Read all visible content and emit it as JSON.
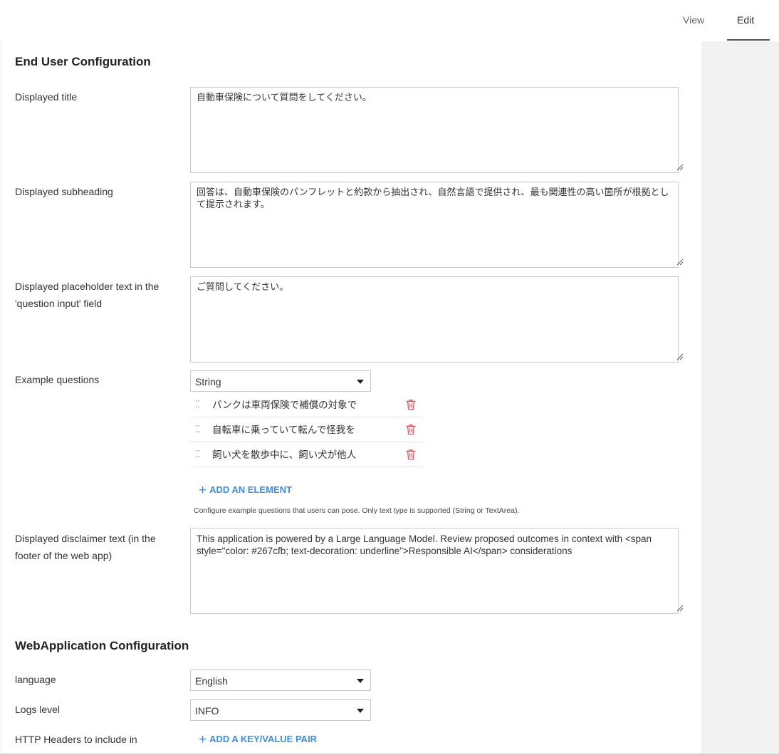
{
  "tabs": {
    "view": "View",
    "edit": "Edit"
  },
  "sections": {
    "end_user": "End User Configuration",
    "webapp": "WebApplication Configuration"
  },
  "fields": {
    "title": {
      "label": "Displayed title",
      "value": "自動車保険について質問をしてください。"
    },
    "subheading": {
      "label": "Displayed subheading",
      "value": "回答は、自動車保険のパンフレットと約款から抽出され、自然言語で提供され、最も関連性の高い箇所が根拠として提示されます。"
    },
    "placeholder": {
      "label": "Displayed placeholder text in the 'question input' field",
      "value": "ご質問してください。"
    },
    "examples": {
      "label": "Example questions",
      "type_value": "String",
      "items": [
        {
          "text": "パンクは車両保険で補償の対象で"
        },
        {
          "text": "自転車に乗っていて転んで怪我を"
        },
        {
          "text": "飼い犬を散歩中に、飼い犬が他人"
        }
      ],
      "add_label": "ADD AN ELEMENT",
      "help": "Configure example questions that users can pose. Only text type is supported (String or TextArea)."
    },
    "disclaimer": {
      "label": "Displayed disclaimer text (in the footer of the web app)",
      "value": "This application is powered by a Large Language Model. Review proposed outcomes in context with <span style=\"color: #267cfb; text-decoration: underline\">Responsible AI</span> considerations"
    },
    "language": {
      "label": "language",
      "value": "English"
    },
    "logs": {
      "label": "Logs level",
      "value": "INFO"
    },
    "headers": {
      "label": "HTTP Headers to include in",
      "add_label": "ADD A KEY/VALUE PAIR"
    }
  },
  "colors": {
    "accent": "#3b8de0",
    "danger": "#e0535a"
  }
}
